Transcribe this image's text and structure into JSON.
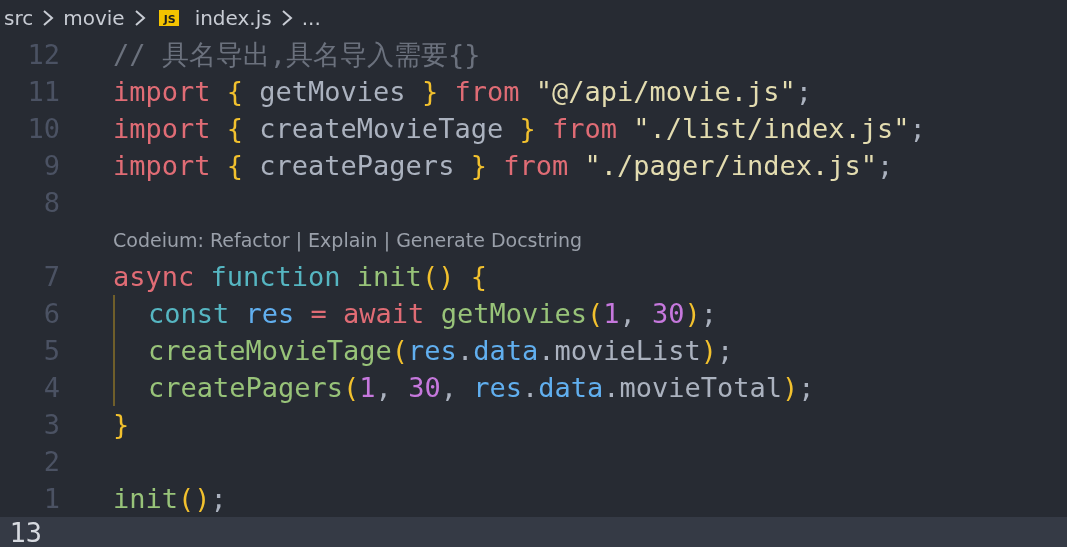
{
  "breadcrumb": {
    "items": [
      {
        "label": "src"
      },
      {
        "label": "movie"
      },
      {
        "label": "index.js",
        "badge": "JS"
      },
      {
        "label": "..."
      }
    ]
  },
  "editor": {
    "lines": [
      {
        "kind": "code",
        "number": "12",
        "current": false,
        "indent_guide": false,
        "tokens": [
          {
            "color": "#6b717d",
            "text": "// 具名导出,具名导入需要{}"
          }
        ]
      },
      {
        "kind": "code",
        "number": "11",
        "current": false,
        "indent_guide": false,
        "tokens": [
          {
            "color": "#e06c75",
            "text": "import"
          },
          {
            "color": "#f2c12e",
            "text": " {"
          },
          {
            "color": "#abb2bf",
            "text": " getMovies"
          },
          {
            "color": "#f2c12e",
            "text": " }"
          },
          {
            "color": "#e06c75",
            "text": " from"
          },
          {
            "color": "#e3dcb0",
            "text": " \"@/api/movie.js\""
          },
          {
            "color": "#abb2bf",
            "text": ";"
          }
        ]
      },
      {
        "kind": "code",
        "number": "10",
        "current": false,
        "indent_guide": false,
        "tokens": [
          {
            "color": "#e06c75",
            "text": "import"
          },
          {
            "color": "#f2c12e",
            "text": " {"
          },
          {
            "color": "#abb2bf",
            "text": " createMovieTage"
          },
          {
            "color": "#f2c12e",
            "text": " }"
          },
          {
            "color": "#e06c75",
            "text": " from"
          },
          {
            "color": "#e3dcb0",
            "text": " \"./list/index.js\""
          },
          {
            "color": "#abb2bf",
            "text": ";"
          }
        ]
      },
      {
        "kind": "code",
        "number": "9",
        "current": false,
        "indent_guide": false,
        "tokens": [
          {
            "color": "#e06c75",
            "text": "import"
          },
          {
            "color": "#f2c12e",
            "text": " {"
          },
          {
            "color": "#abb2bf",
            "text": " createPagers"
          },
          {
            "color": "#f2c12e",
            "text": " }"
          },
          {
            "color": "#e06c75",
            "text": " from"
          },
          {
            "color": "#e3dcb0",
            "text": " \"./pager/index.js\""
          },
          {
            "color": "#abb2bf",
            "text": ";"
          }
        ]
      },
      {
        "kind": "code",
        "number": "8",
        "current": false,
        "indent_guide": false
      },
      {
        "kind": "codelens",
        "text": "Codeium: Refactor | Explain | Generate Docstring"
      },
      {
        "kind": "code",
        "number": "7",
        "current": false,
        "indent_guide": false,
        "tokens": [
          {
            "color": "#e06c75",
            "text": "async"
          },
          {
            "color": "#56b6c2",
            "text": " function"
          },
          {
            "color": "#98c379",
            "text": " init"
          },
          {
            "color": "#f2c12e",
            "text": "()"
          },
          {
            "color": "#f2c12e",
            "text": " {"
          }
        ]
      },
      {
        "kind": "code",
        "number": "6",
        "current": false,
        "indent_guide": true,
        "tokens": [
          {
            "color": "#56b6c2",
            "text": "const"
          },
          {
            "color": "#61afef",
            "text": " res"
          },
          {
            "color": "#e06c75",
            "text": " ="
          },
          {
            "color": "#e06c75",
            "text": " await"
          },
          {
            "color": "#98c379",
            "text": " getMovies"
          },
          {
            "color": "#f2c12e",
            "text": "("
          },
          {
            "color": "#c678dd",
            "text": "1"
          },
          {
            "color": "#abb2bf",
            "text": ","
          },
          {
            "color": "#c678dd",
            "text": " 30"
          },
          {
            "color": "#f2c12e",
            "text": ")"
          },
          {
            "color": "#abb2bf",
            "text": ";"
          }
        ]
      },
      {
        "kind": "code",
        "number": "5",
        "current": false,
        "indent_guide": true,
        "tokens": [
          {
            "color": "#98c379",
            "text": "createMovieTage"
          },
          {
            "color": "#f2c12e",
            "text": "("
          },
          {
            "color": "#61afef",
            "text": "res"
          },
          {
            "color": "#abb2bf",
            "text": "."
          },
          {
            "color": "#61afef",
            "text": "data"
          },
          {
            "color": "#abb2bf",
            "text": ".movieList"
          },
          {
            "color": "#f2c12e",
            "text": ")"
          },
          {
            "color": "#abb2bf",
            "text": ";"
          }
        ]
      },
      {
        "kind": "code",
        "number": "4",
        "current": false,
        "indent_guide": true,
        "tokens": [
          {
            "color": "#98c379",
            "text": "createPagers"
          },
          {
            "color": "#f2c12e",
            "text": "("
          },
          {
            "color": "#c678dd",
            "text": "1"
          },
          {
            "color": "#abb2bf",
            "text": ","
          },
          {
            "color": "#c678dd",
            "text": " 30"
          },
          {
            "color": "#abb2bf",
            "text": ","
          },
          {
            "color": "#61afef",
            "text": " res"
          },
          {
            "color": "#abb2bf",
            "text": "."
          },
          {
            "color": "#61afef",
            "text": "data"
          },
          {
            "color": "#abb2bf",
            "text": ".movieTotal"
          },
          {
            "color": "#f2c12e",
            "text": ")"
          },
          {
            "color": "#abb2bf",
            "text": ";"
          }
        ]
      },
      {
        "kind": "code",
        "number": "3",
        "current": false,
        "indent_guide": false,
        "tokens": [
          {
            "color": "#f2c12e",
            "text": "}"
          }
        ]
      },
      {
        "kind": "code",
        "number": "2",
        "current": false,
        "indent_guide": false
      },
      {
        "kind": "code",
        "number": "1",
        "current": false,
        "indent_guide": false,
        "tokens": [
          {
            "color": "#98c379",
            "text": "init"
          },
          {
            "color": "#f2c12e",
            "text": "()"
          },
          {
            "color": "#abb2bf",
            "text": ";"
          }
        ]
      },
      {
        "kind": "code",
        "number": "13",
        "current": true,
        "indent_guide": false
      }
    ]
  }
}
